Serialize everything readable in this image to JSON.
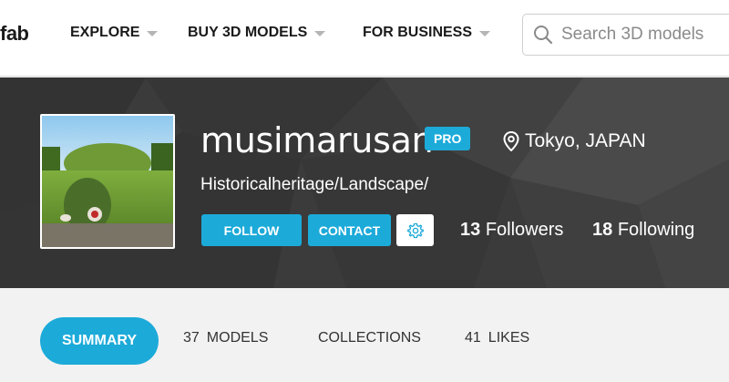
{
  "nav": {
    "logo": "fab",
    "items": [
      {
        "label": "EXPLORE"
      },
      {
        "label": "BUY 3D MODELS"
      },
      {
        "label": "FOR BUSINESS"
      }
    ],
    "search_placeholder": "Search 3D models"
  },
  "profile": {
    "username": "musimarusan",
    "badge": "PRO",
    "location": "Tokyo, JAPAN",
    "tagline": "Historicalheritage/Landscape/",
    "follow_label": "FOLLOW",
    "contact_label": "CONTACT",
    "followers_count": "13",
    "followers_label": "Followers",
    "following_count": "18",
    "following_label": "Following"
  },
  "tabs": {
    "summary": "SUMMARY",
    "models_count": "37",
    "models_label": "MODELS",
    "collections_label": "COLLECTIONS",
    "likes_count": "41",
    "likes_label": "LIKES"
  },
  "colors": {
    "accent": "#1caad9",
    "banner": "#3a3a3a"
  }
}
